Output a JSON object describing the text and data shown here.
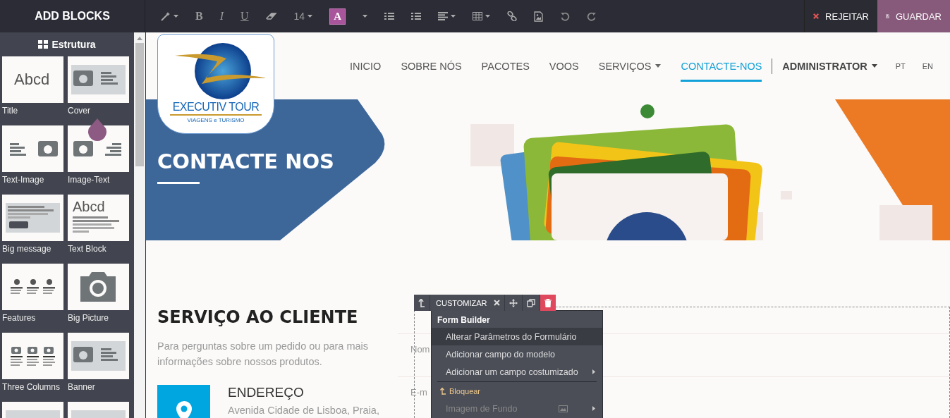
{
  "sidebar": {
    "title": "ADD BLOCKS",
    "section": "Estrutura",
    "blocks": [
      {
        "kind": "title",
        "label": "Title",
        "thumb_text": "Abcd"
      },
      {
        "kind": "cover",
        "label": "Cover"
      },
      {
        "kind": "text-image",
        "label": "Text-Image"
      },
      {
        "kind": "image-text",
        "label": "Image-Text"
      },
      {
        "kind": "big-message",
        "label": "Big message"
      },
      {
        "kind": "text-block",
        "label": "Text Block",
        "thumb_text": "Abcd"
      },
      {
        "kind": "features",
        "label": "Features"
      },
      {
        "kind": "big-picture",
        "label": "Big Picture"
      },
      {
        "kind": "three-columns",
        "label": "Three Columns"
      },
      {
        "kind": "banner",
        "label": "Banner"
      },
      {
        "kind": "partial"
      },
      {
        "kind": "partial"
      }
    ]
  },
  "toolbar": [
    {
      "kind": "magic",
      "caret": true
    },
    {
      "kind": "bold",
      "label": "B"
    },
    {
      "kind": "italic",
      "label": "I"
    },
    {
      "kind": "underline",
      "label": "U"
    },
    {
      "kind": "eraser"
    },
    {
      "kind": "size",
      "label": "14",
      "caret": true
    },
    {
      "kind": "color",
      "label": "A",
      "caret": true
    },
    {
      "kind": "bullets"
    },
    {
      "kind": "numbers"
    },
    {
      "kind": "align",
      "caret": true
    },
    {
      "kind": "table",
      "caret": true
    },
    {
      "kind": "link"
    },
    {
      "kind": "image"
    },
    {
      "kind": "undo"
    },
    {
      "kind": "redo"
    }
  ],
  "actions": [
    {
      "kind": "discard",
      "label": "REJEITAR"
    },
    {
      "kind": "save",
      "label": "GUARDAR"
    }
  ],
  "logo": {
    "name": "EXECUTIV TOUR",
    "tagline": "VIAGENS e TURISMO"
  },
  "nav": [
    {
      "label": "INICIO",
      "selected": false,
      "caret": false,
      "kind": "link"
    },
    {
      "label": "SOBRE NÓS",
      "selected": false,
      "caret": false,
      "kind": "link"
    },
    {
      "label": "PACOTES",
      "selected": false,
      "caret": false,
      "kind": "link"
    },
    {
      "label": "VOOS",
      "selected": false,
      "caret": false,
      "kind": "link"
    },
    {
      "label": "SERVIÇOS",
      "selected": false,
      "caret": true,
      "kind": "link"
    },
    {
      "label": "CONTACTE-NOS",
      "selected": true,
      "caret": false,
      "kind": "link"
    },
    {
      "label": "ADMINISTRATOR",
      "selected": false,
      "caret": true,
      "kind": "user"
    },
    {
      "label": "PT",
      "selected": false,
      "caret": false,
      "kind": "lang"
    },
    {
      "label": "EN",
      "selected": false,
      "caret": false,
      "kind": "lang"
    }
  ],
  "hero": {
    "title": "CONTACTE NOS"
  },
  "section": {
    "heading": "SERVIÇO AO CLIENTE",
    "text": "Para perguntas sobre um pedido ou para mais informações sobre nossos produtos.",
    "address_title": "ENDEREÇO",
    "address": "Avenida Cidade de Lisboa, Praia,"
  },
  "form": {
    "fields": [
      {
        "label": "Nom"
      },
      {
        "label": "E-m"
      }
    ]
  },
  "block_toolbar": {
    "label": "CUSTOMIZAR"
  },
  "menu": [
    {
      "kind": "header",
      "label": "Form Builder"
    },
    {
      "kind": "item",
      "label": "Alterar Parâmetros do Formulário",
      "selected": true
    },
    {
      "kind": "item",
      "label": "Adicionar campo do modelo",
      "selected": false
    },
    {
      "kind": "submenu",
      "label": "Adicionar um campo costumizado",
      "selected": false
    },
    {
      "kind": "divider"
    },
    {
      "kind": "lock",
      "label": "Bloquear",
      "selected": false
    },
    {
      "kind": "image-submenu",
      "label": "Imagem de Fundo",
      "selected": false
    }
  ]
}
